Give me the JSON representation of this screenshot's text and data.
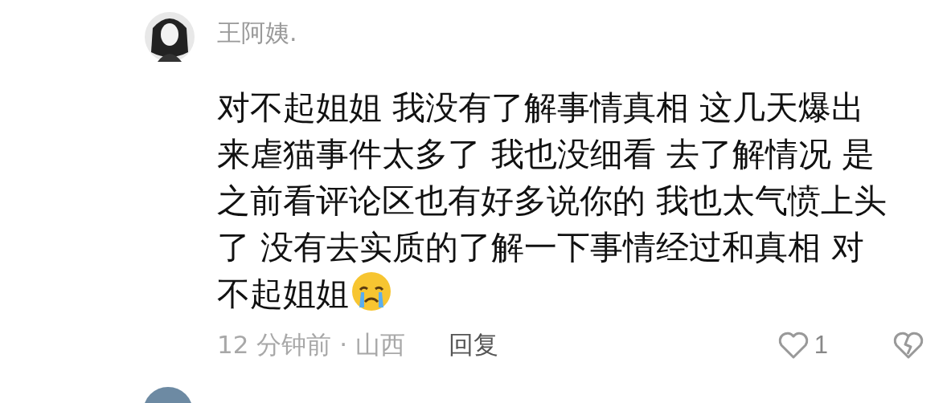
{
  "comment": {
    "author": "王阿姨.",
    "text": "对不起姐姐 我没有了解事情真相 这几天爆出来虐猫事件太多了 我也没细看 去了解情况 是之前看评论区也有好多说你的 我也太气愤上头了 没有去实质的了解一下事情经过和真相 对不起姐姐",
    "time_location": "12 分钟前 · 山西",
    "reply_label": "回复",
    "like_count": "1",
    "liked": false
  }
}
